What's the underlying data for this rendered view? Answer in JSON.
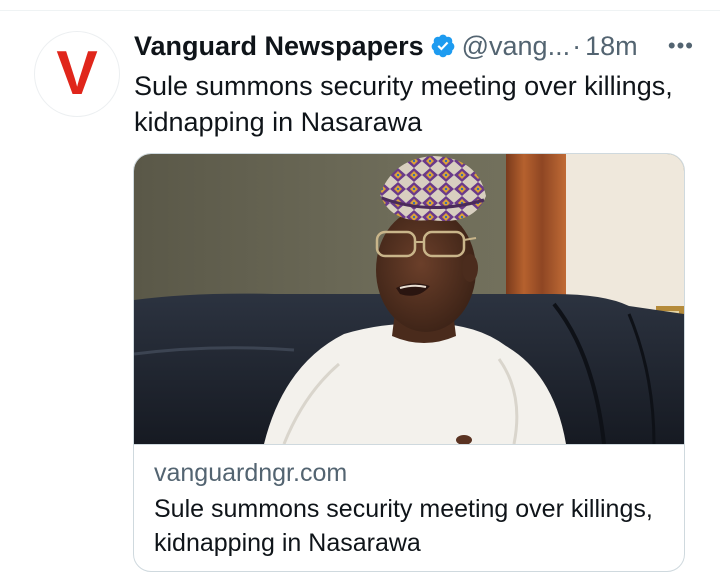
{
  "tweet": {
    "author": {
      "display_name": "Vanguard Newspapers",
      "avatar_letter": "V",
      "handle": "@vang...",
      "verified": true
    },
    "separator": "·",
    "time": "18m",
    "more_label": "•••",
    "text": "Sule summons security meeting over killings, kidnapping in Nasarawa",
    "card": {
      "domain": "vanguardngr.com",
      "title": "Sule summons security meeting over killings, kidnapping in Nasarawa"
    }
  },
  "colors": {
    "brand_red": "#e0261b",
    "verified_blue": "#1d9bf0",
    "secondary_text": "#536471",
    "border": "#cfd9de"
  },
  "icons": {
    "verified": "verified-badge-icon",
    "more": "more-dots-icon"
  }
}
